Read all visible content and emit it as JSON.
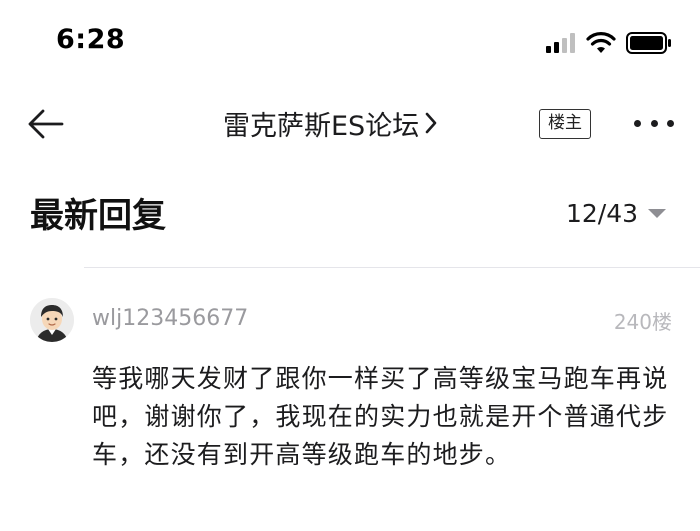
{
  "status_bar": {
    "time": "6:28"
  },
  "nav": {
    "forum_title": "雷克萨斯ES论坛",
    "owner_badge": "楼主"
  },
  "section": {
    "title": "最新回复",
    "page_indicator": "12/43"
  },
  "reply": {
    "username": "wlj123456677",
    "floor": "240楼",
    "content": "等我哪天发财了跟你一样买了高等级宝马跑车再说吧，谢谢你了，我现在的实力也就是开个普通代步车，还没有到开高等级跑车的地步。"
  },
  "icons": {
    "signal": "cellular-signal-icon",
    "wifi": "wifi-icon",
    "battery": "battery-icon",
    "back": "back-arrow-icon",
    "chevron": "chevron-right-icon",
    "more": "more-dots-icon",
    "caret": "caret-down-icon"
  }
}
